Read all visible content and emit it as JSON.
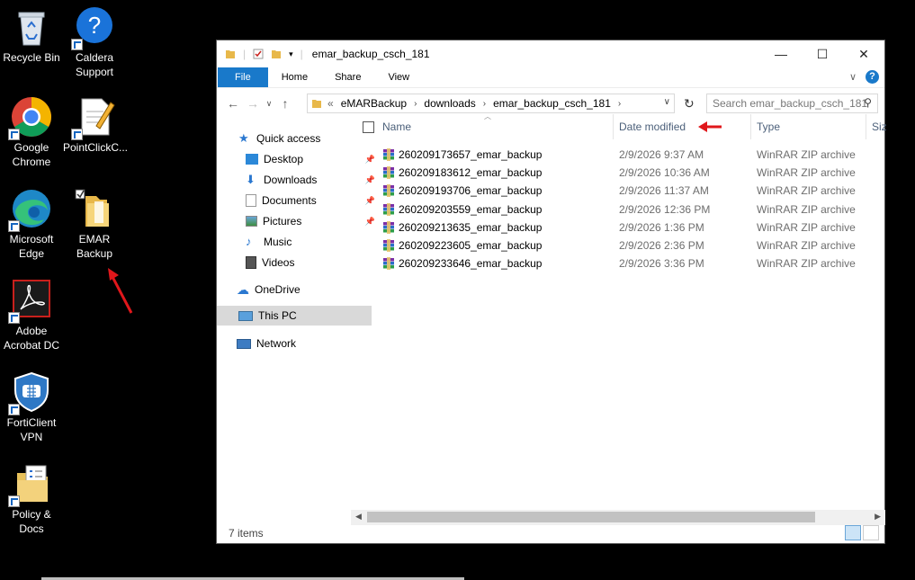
{
  "desktop": {
    "icons": [
      {
        "label": "Recycle Bin",
        "icon": "recycle-bin-icon"
      },
      {
        "label": "Caldera Support",
        "icon": "help-icon"
      },
      {
        "label": "Google Chrome",
        "icon": "chrome-icon"
      },
      {
        "label": "PointClickC...",
        "icon": "notepad-icon"
      },
      {
        "label": "Microsoft Edge",
        "icon": "edge-icon"
      },
      {
        "label": "EMAR Backup",
        "icon": "folder-icon"
      },
      {
        "label": "Adobe Acrobat DC",
        "icon": "acrobat-icon"
      },
      {
        "label": "FortiClient VPN",
        "icon": "forticlient-icon"
      },
      {
        "label": "Policy & Docs",
        "icon": "policy-folder-icon"
      }
    ]
  },
  "window": {
    "title": "emar_backup_csch_181",
    "controls": {
      "minimize": "—",
      "maximize": "☐",
      "close": "✕"
    },
    "ribbon": {
      "tabs": [
        "File",
        "Home",
        "Share",
        "View"
      ],
      "help": "?"
    },
    "address": {
      "overflow": "«",
      "segments": [
        "eMARBackup",
        "downloads",
        "emar_backup_csch_181"
      ]
    },
    "search": {
      "placeholder": "Search emar_backup_csch_181"
    },
    "nav_pane": {
      "quick_access": "Quick access",
      "items": [
        {
          "label": "Desktop",
          "pinned": true
        },
        {
          "label": "Downloads",
          "pinned": true
        },
        {
          "label": "Documents",
          "pinned": true
        },
        {
          "label": "Pictures",
          "pinned": true
        },
        {
          "label": "Music",
          "pinned": false
        },
        {
          "label": "Videos",
          "pinned": false
        }
      ],
      "onedrive": "OneDrive",
      "this_pc": "This PC",
      "network": "Network"
    },
    "columns": {
      "name": "Name",
      "date": "Date modified",
      "type": "Type",
      "size": "Size"
    },
    "files": [
      {
        "name": "260209173657_emar_backup",
        "date": "2/9/2026 9:37 AM",
        "type": "WinRAR ZIP archive"
      },
      {
        "name": "260209183612_emar_backup",
        "date": "2/9/2026 10:36 AM",
        "type": "WinRAR ZIP archive"
      },
      {
        "name": "260209193706_emar_backup",
        "date": "2/9/2026 11:37 AM",
        "type": "WinRAR ZIP archive"
      },
      {
        "name": "260209203559_emar_backup",
        "date": "2/9/2026 12:36 PM",
        "type": "WinRAR ZIP archive"
      },
      {
        "name": "260209213635_emar_backup",
        "date": "2/9/2026 1:36 PM",
        "type": "WinRAR ZIP archive"
      },
      {
        "name": "260209223605_emar_backup",
        "date": "2/9/2026 2:36 PM",
        "type": "WinRAR ZIP archive"
      },
      {
        "name": "260209233646_emar_backup",
        "date": "2/9/2026 3:36 PM",
        "type": "WinRAR ZIP archive"
      }
    ],
    "status": {
      "item_count": "7 items"
    }
  },
  "colors": {
    "accent": "#1979ca",
    "annotation": "#e0171b"
  }
}
